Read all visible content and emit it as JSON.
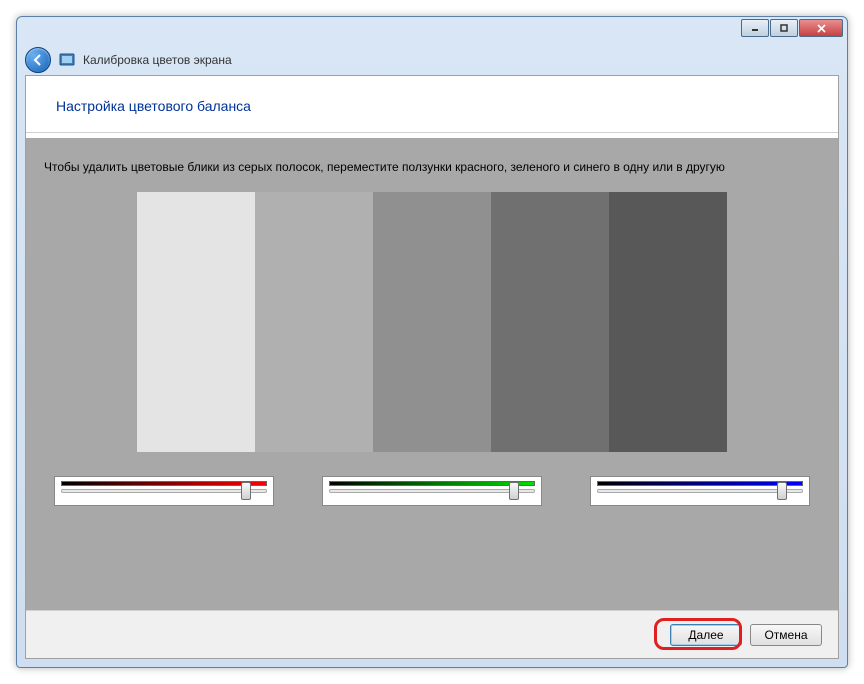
{
  "window": {
    "app_title": "Калибровка цветов экрана"
  },
  "page": {
    "title": "Настройка цветового баланса",
    "instruction": "Чтобы удалить цветовые блики из серых полосок, переместите ползунки красного, зеленого и синего в одну или в другую"
  },
  "gray_bars": [
    {
      "color": "#e4e4e4"
    },
    {
      "color": "#b0b0b0"
    },
    {
      "color": "#909090"
    },
    {
      "color": "#707070"
    },
    {
      "color": "#585858"
    }
  ],
  "sliders": {
    "red": {
      "position_percent": 90
    },
    "green": {
      "position_percent": 90
    },
    "blue": {
      "position_percent": 90
    }
  },
  "buttons": {
    "next": "Далее",
    "cancel": "Отмена"
  }
}
